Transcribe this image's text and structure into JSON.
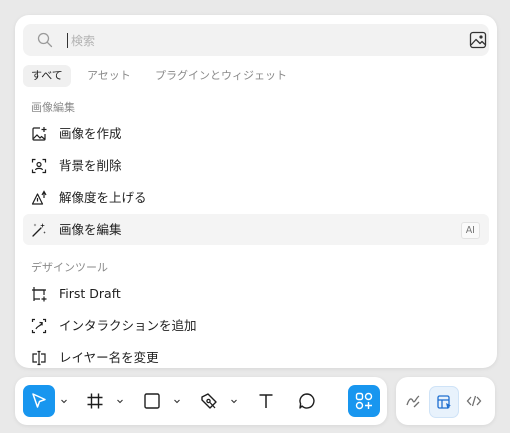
{
  "search": {
    "placeholder": "検索",
    "value": ""
  },
  "tabs": [
    {
      "label": "すべて",
      "active": true
    },
    {
      "label": "アセット",
      "active": false
    },
    {
      "label": "プラグインとウィジェット",
      "active": false
    }
  ],
  "sections": [
    {
      "title": "画像編集",
      "items": [
        {
          "label": "画像を作成",
          "icon": "image-plus-icon"
        },
        {
          "label": "背景を削除",
          "icon": "remove-background-icon"
        },
        {
          "label": "解像度を上げる",
          "icon": "upscale-icon"
        },
        {
          "label": "画像を編集",
          "icon": "magic-wand-icon",
          "badge": "AI"
        }
      ]
    },
    {
      "title": "デザインツール",
      "items": [
        {
          "label": "First Draft",
          "icon": "first-draft-icon"
        },
        {
          "label": "インタラクションを追加",
          "icon": "interaction-icon"
        },
        {
          "label": "レイヤー名を変更",
          "icon": "rename-layer-icon"
        }
      ]
    }
  ],
  "toolbar": {
    "tools": [
      "move-tool",
      "frame-tool",
      "shape-tool",
      "pen-tool",
      "text-tool",
      "comment-tool",
      "actions-tool"
    ],
    "selected": "actions-tool"
  },
  "modes": {
    "items": [
      "draw-mode",
      "design-mode",
      "dev-mode"
    ],
    "selected": "design-mode"
  },
  "colors": {
    "accent": "#1896ef",
    "selected_mode_bg": "#e8f2fc"
  }
}
